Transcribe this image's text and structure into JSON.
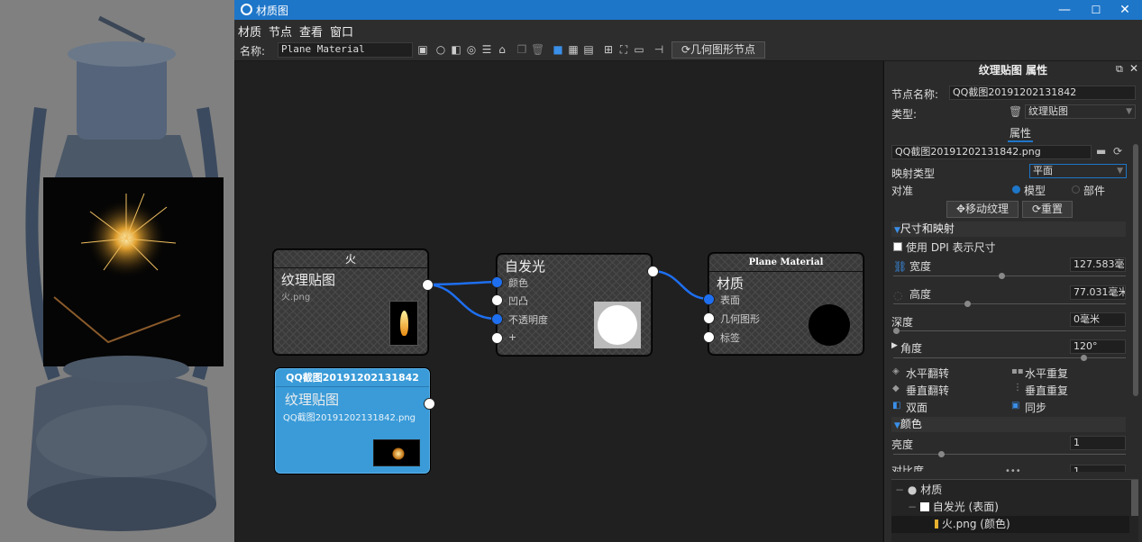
{
  "window": {
    "title": "材质图",
    "min": "—",
    "max": "☐",
    "close": "✕"
  },
  "menu": [
    "材质",
    "节点",
    "查看",
    "窗口"
  ],
  "toolbar": {
    "name_label": "名称:",
    "name_value": "Plane Material",
    "geometry_node_label": "几何图形节点"
  },
  "nodes": {
    "fire": {
      "header": "火",
      "type": "纹理贴图",
      "file": "火.png"
    },
    "emission": {
      "header": "自发光",
      "ports": [
        "颜色",
        "凹凸",
        "不透明度",
        "+"
      ]
    },
    "material": {
      "header": "Plane Material",
      "type": "材质",
      "ports": [
        "表面",
        "几何图形",
        "标签"
      ]
    },
    "qq": {
      "header": "QQ截图20191202131842",
      "type": "纹理贴图",
      "file": "QQ截图20191202131842.png"
    }
  },
  "panel": {
    "title": "纹理贴图 属性",
    "node_name_label": "节点名称:",
    "node_name_value": "QQ截图20191202131842",
    "type_label": "类型:",
    "type_value": "纹理贴图",
    "tab": "属性",
    "file_value": "QQ截图20191202131842.png",
    "mapping_label": "映射类型",
    "mapping_value": "平面",
    "align_label": "对准",
    "align_model": "模型",
    "align_part": "部件",
    "move_texture": "移动纹理",
    "reset": "重置",
    "size_section": "尺寸和映射",
    "dpi_label": "使用 DPI 表示尺寸",
    "width_label": "宽度",
    "width_value": "127.583毫米",
    "height_label": "高度",
    "height_value": "77.031毫米",
    "depth_label": "深度",
    "depth_value": "0毫米",
    "angle_label": "角度",
    "angle_value": "120°",
    "flip_h": "水平翻转",
    "repeat_h": "水平重复",
    "flip_v": "垂直翻转",
    "repeat_v": "垂直重复",
    "double_side": "双面",
    "sync": "同步",
    "color_section": "颜色",
    "brightness_label": "亮度",
    "brightness_value": "1",
    "contrast_label": "对比度",
    "contrast_value": "1",
    "more": "•••"
  },
  "tree": {
    "root": "材质",
    "child": "自发光 (表面)",
    "leaf": "火.png (颜色)"
  },
  "colors": {
    "accent": "#1e76c9",
    "selected_node": "#3a9bd8",
    "wire": "#1e6ff0"
  }
}
